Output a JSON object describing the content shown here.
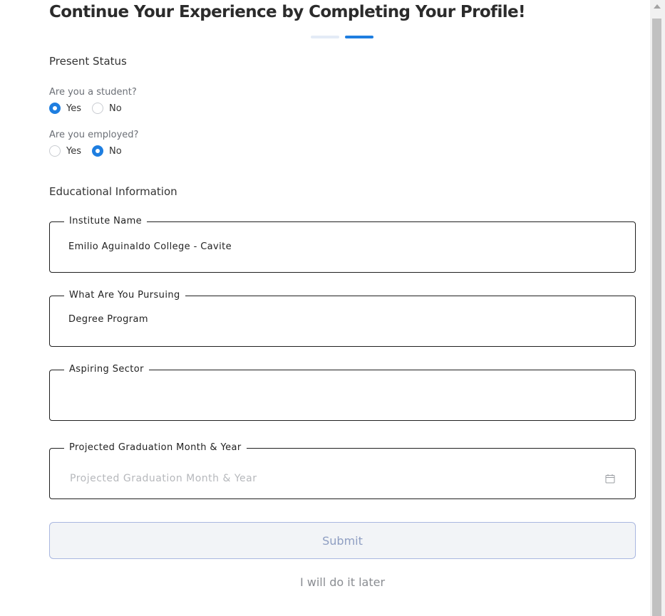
{
  "header": {
    "title": "Continue Your Experience by Completing Your Profile!"
  },
  "progress": {
    "total_steps": 2,
    "current_step": 2,
    "active_color": "#1e7ee0",
    "inactive_color": "#e3ebf6"
  },
  "present_status": {
    "title": "Present Status",
    "student": {
      "question": "Are you a student?",
      "options": [
        "Yes",
        "No"
      ],
      "selected": "Yes"
    },
    "employed": {
      "question": "Are you employed?",
      "options": [
        "Yes",
        "No"
      ],
      "selected": "No"
    }
  },
  "education": {
    "title": "Educational Information",
    "institute": {
      "label": "Institute Name",
      "value": "Emilio Aguinaldo College - Cavite"
    },
    "pursuing": {
      "label": "What Are You Pursuing",
      "value": "Degree Program"
    },
    "sector": {
      "label": "Aspiring Sector",
      "value": ""
    },
    "graduation": {
      "label": "Projected Graduation Month & Year",
      "placeholder": "Projected Graduation Month & Year",
      "icon": "calendar-icon"
    }
  },
  "actions": {
    "submit_label": "Submit",
    "later_label": "I will do it later"
  },
  "colors": {
    "accent": "#1e7ee0",
    "submit_border": "#a9b7e0",
    "submit_text": "#8e9ec2"
  }
}
